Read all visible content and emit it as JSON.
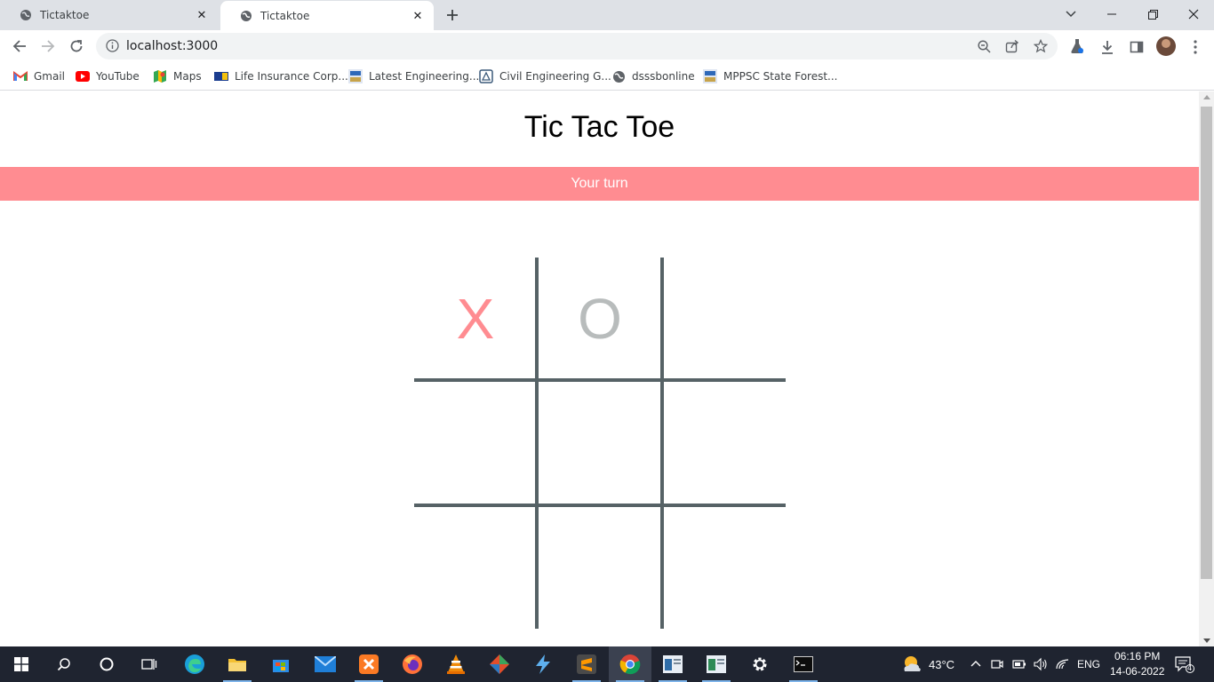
{
  "browser": {
    "tabs": [
      {
        "title": "Tictaktoe",
        "active": false
      },
      {
        "title": "Tictaktoe",
        "active": true
      }
    ],
    "url": "localhost:3000",
    "bookmarks": [
      {
        "label": "Gmail",
        "icon": "gmail-icon"
      },
      {
        "label": "YouTube",
        "icon": "youtube-icon"
      },
      {
        "label": "Maps",
        "icon": "maps-icon"
      },
      {
        "label": "Life Insurance Corp...",
        "icon": "lic-icon"
      },
      {
        "label": "Latest Engineering...",
        "icon": "free-job-alert-icon"
      },
      {
        "label": "Civil Engineering G...",
        "icon": "civil-engineering-icon"
      },
      {
        "label": "dsssbonline",
        "icon": "globe-icon"
      },
      {
        "label": "MPPSC State Forest...",
        "icon": "free-job-alert-icon"
      }
    ]
  },
  "game": {
    "title": "Tic Tac Toe",
    "status": "Your turn",
    "cells": [
      "X",
      "O",
      "",
      "",
      "",
      "",
      "",
      "",
      ""
    ],
    "colors": {
      "x": "#ff8c91",
      "o": "#b8bcbc",
      "grid": "#566266",
      "status_bar": "#ff8c91"
    }
  },
  "taskbar": {
    "weather": "43°C",
    "language": "ENG",
    "time": "06:16 PM",
    "date": "14-06-2022",
    "notifications": "4"
  }
}
